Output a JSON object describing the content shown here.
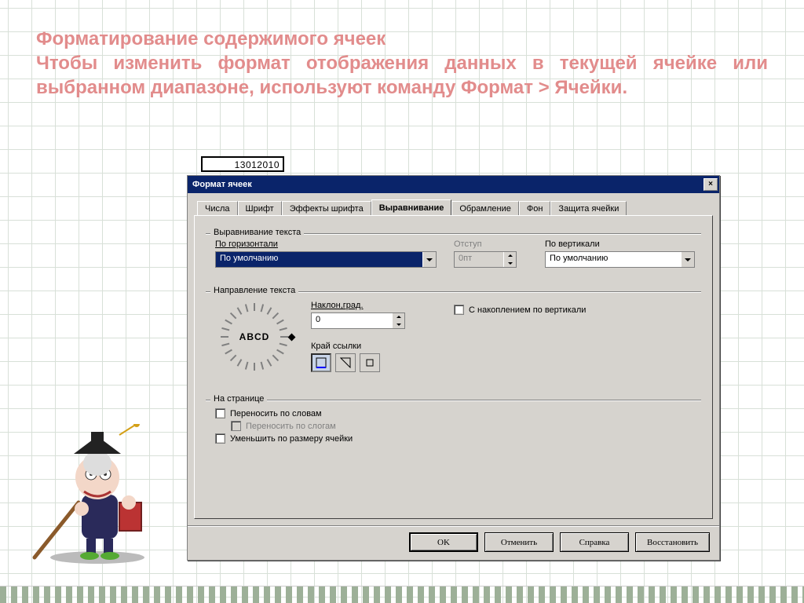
{
  "heading": "Форматирование содержимого ячеек\nЧтобы изменить формат отображения данных в текущей ячейке или выбранном диапазоне, используют команду Формат > Ячейки.",
  "cell_value": "13012010",
  "dialog": {
    "title": "Формат ячеек",
    "close": "×",
    "tabs": [
      "Числа",
      "Шрифт",
      "Эффекты шрифта",
      "Выравнивание",
      "Обрамление",
      "Фон",
      "Защита ячейки"
    ],
    "active_tab_index": 3,
    "group_align": {
      "legend": "Выравнивание текста",
      "horiz_label": "По горизонтали",
      "horiz_value": "По умолчанию",
      "indent_label": "Отступ",
      "indent_value": "0пт",
      "vert_label": "По вертикали",
      "vert_value": "По умолчанию"
    },
    "group_dir": {
      "legend": "Направление текста",
      "abcd": "ABCD",
      "tilt_label": "Наклон,град.",
      "tilt_value": "0",
      "stack_label": "С накоплением по вертикали",
      "edge_label": "Край ссылки"
    },
    "group_page": {
      "legend": "На странице",
      "wrap_words": "Переносить по словам",
      "wrap_syll": "Переносить по слогам",
      "shrink": "Уменьшить по размеру ячейки"
    },
    "buttons": {
      "ok": "OK",
      "cancel": "Отменить",
      "help": "Справка",
      "reset": "Восстановить"
    }
  }
}
